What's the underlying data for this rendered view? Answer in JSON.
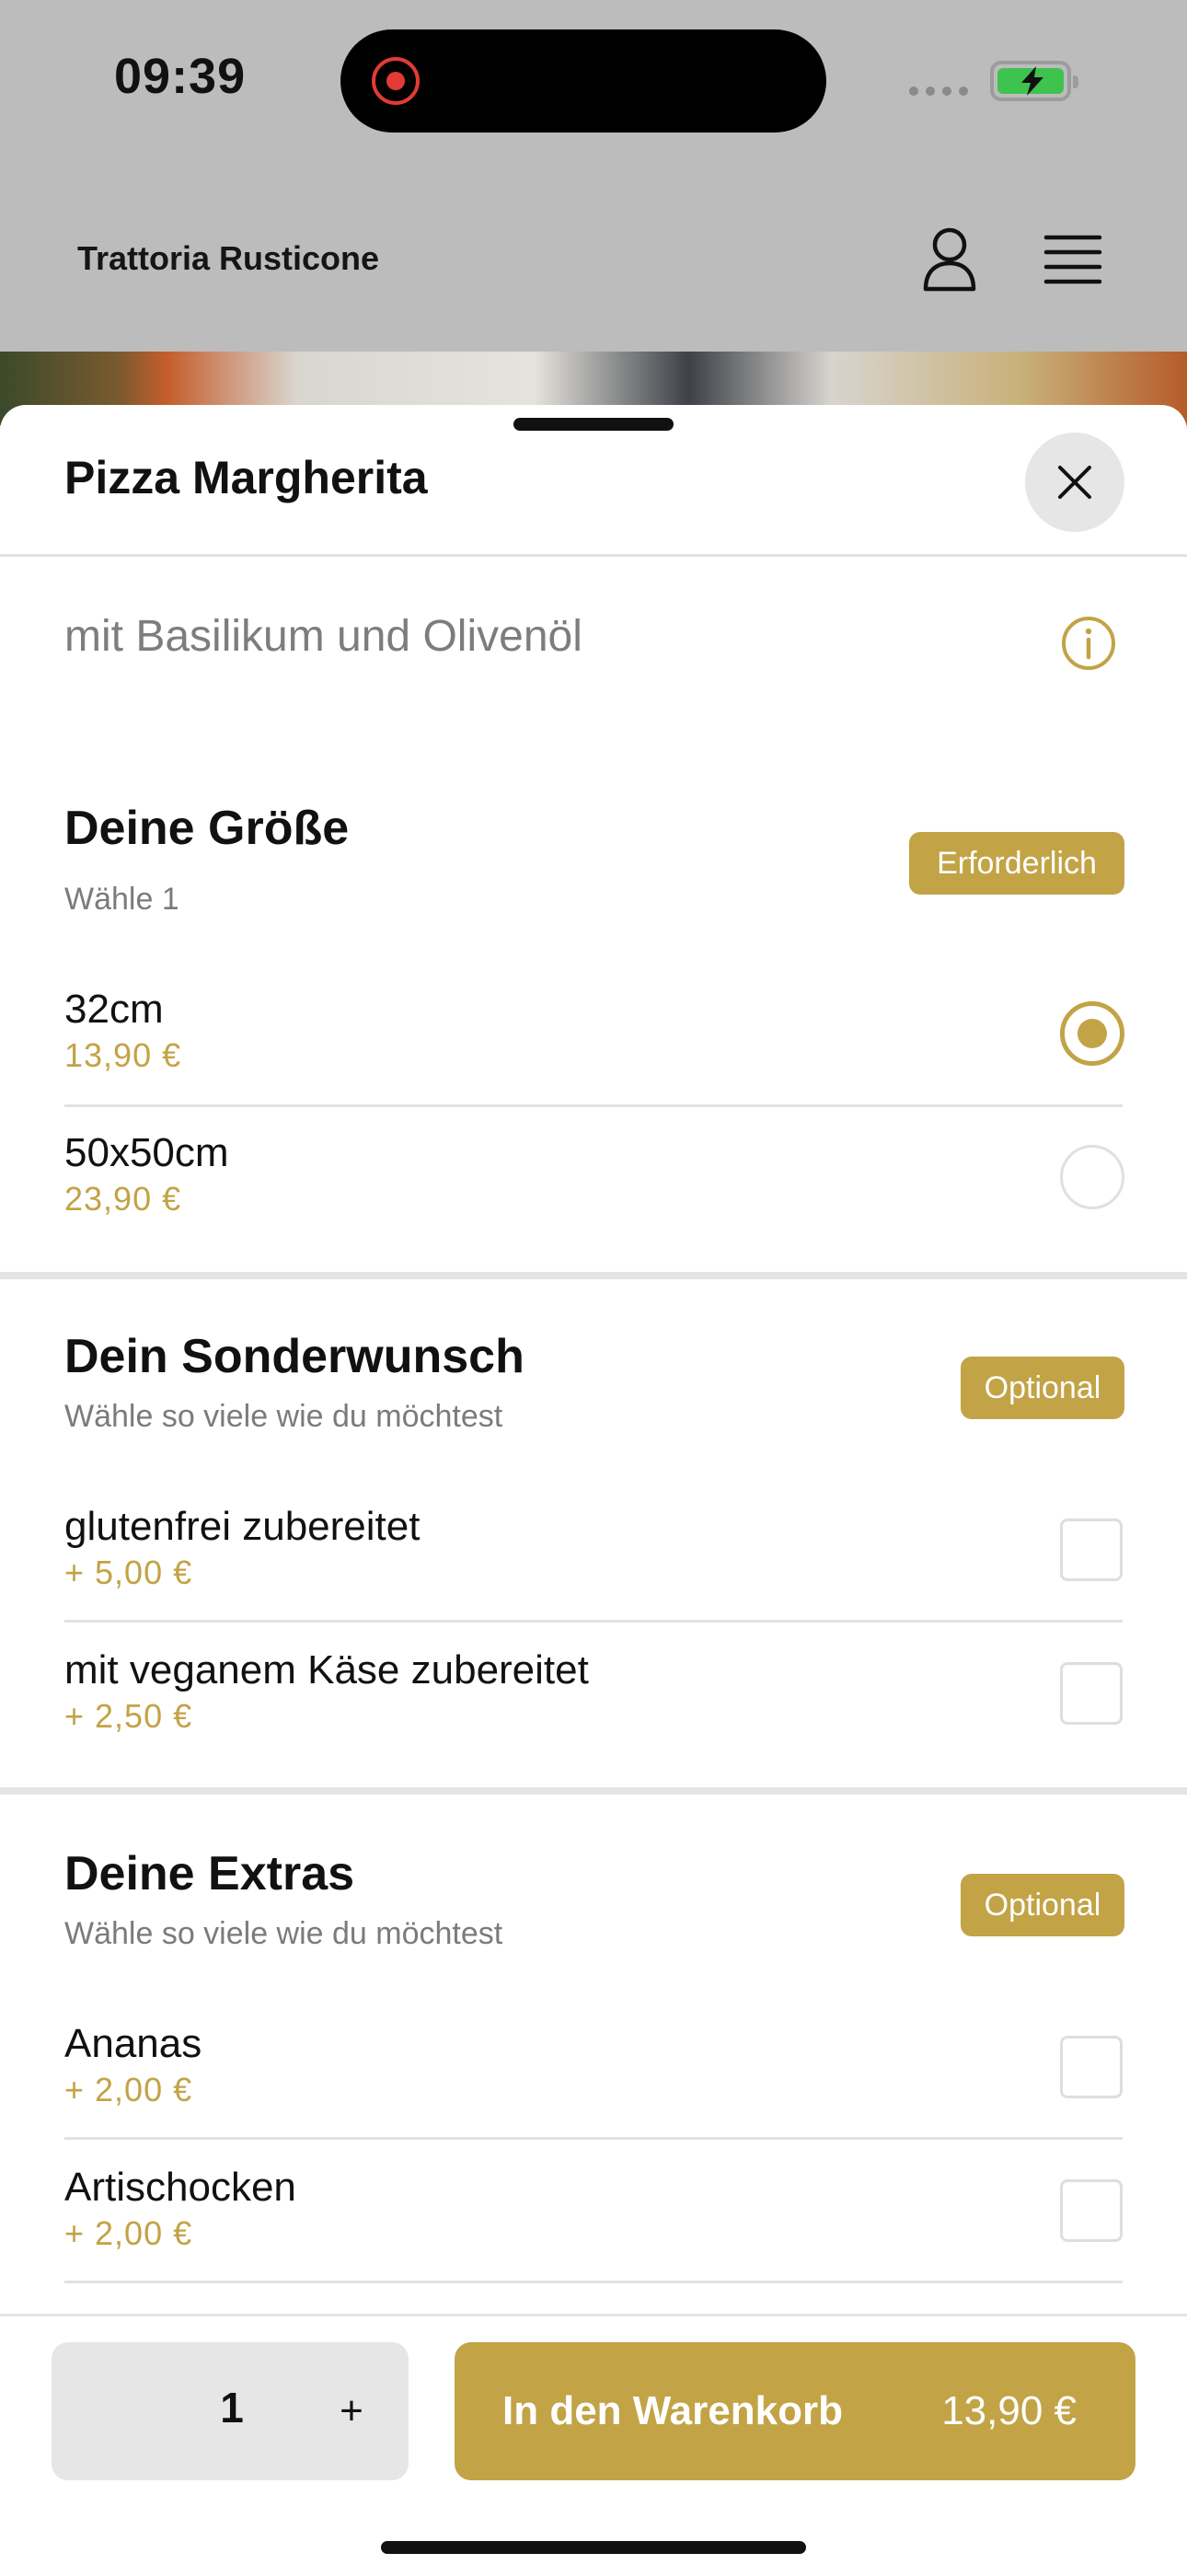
{
  "status_bar": {
    "time": "09:39"
  },
  "header": {
    "brand": "Trattoria Rusticone"
  },
  "product": {
    "title": "Pizza Margherita",
    "description": "mit Basilikum und Olivenöl"
  },
  "sections": [
    {
      "title": "Deine Größe",
      "subtitle": "Wähle 1",
      "badge": "Erforderlich",
      "options": [
        {
          "name": "32cm",
          "price": "13,90 €",
          "selected": true
        },
        {
          "name": "50x50cm",
          "price": "23,90 €",
          "selected": false
        }
      ]
    },
    {
      "title": "Dein Sonderwunsch",
      "subtitle": "Wähle so viele wie du möchtest",
      "badge": "Optional",
      "options": [
        {
          "name": "glutenfrei zubereitet",
          "price": "+ 5,00 €",
          "selected": false
        },
        {
          "name": "mit veganem Käse zubereitet",
          "price": "+ 2,50 €",
          "selected": false
        }
      ]
    },
    {
      "title": "Deine Extras",
      "subtitle": "Wähle so viele wie du möchtest",
      "badge": "Optional",
      "options": [
        {
          "name": "Ananas",
          "price": "+ 2,00 €",
          "selected": false
        },
        {
          "name": "Artischocken",
          "price": "+ 2,00 €",
          "selected": false
        }
      ]
    }
  ],
  "footer": {
    "quantity": "1",
    "plus": "+",
    "add_label": "In den Warenkorb",
    "total": "13,90 €"
  },
  "colors": {
    "accent": "#c2a346",
    "backdrop": "#bcbcbc"
  }
}
